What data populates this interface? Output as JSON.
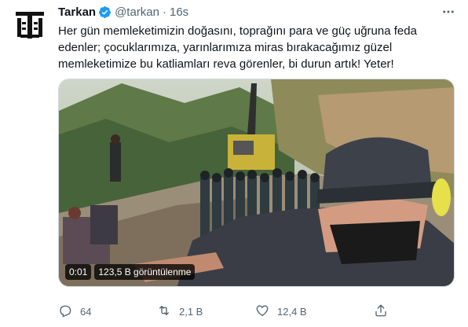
{
  "avatar": {
    "text": "TARKAN"
  },
  "author": {
    "name": "Tarkan",
    "handle": "@tarkan",
    "separator": "·",
    "time": "16s"
  },
  "tweet": {
    "lines": [
      "Her gün memleketimizin doğasını, toprağını para ve güç uğruna feda",
      "edenler; çocuklarımıza, yarınlarımıza miras bırakacağımız güzel",
      "memleketimize bu katliamları reva görenler, bi durun artık! Yeter!"
    ]
  },
  "video": {
    "duration": "0:01",
    "views": "123,5 B görüntülenme"
  },
  "actions": {
    "replies": "64",
    "retweets": "2,1 B",
    "likes": "12,4 B"
  },
  "icons": [
    "verified-icon",
    "more-icon",
    "reply-icon",
    "retweet-icon",
    "like-icon",
    "share-icon"
  ],
  "colors": {
    "verified": "#1d9bf0",
    "meta": "#536471",
    "text": "#0f1419"
  }
}
